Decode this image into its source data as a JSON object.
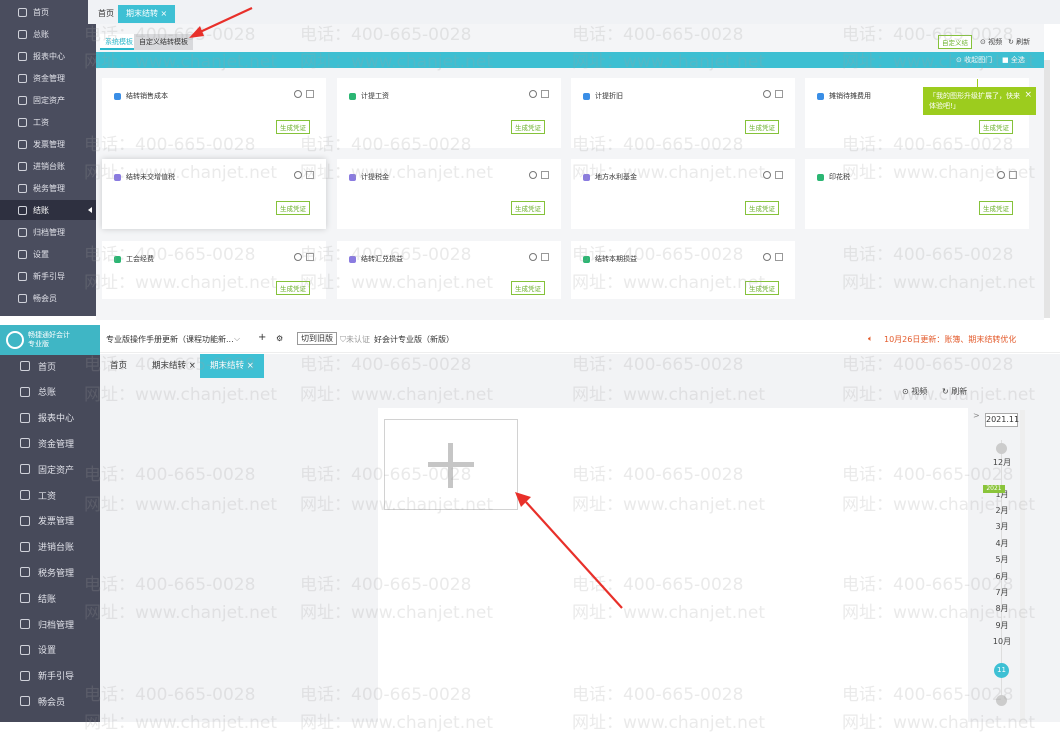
{
  "colors": {
    "accent": "#3ec0d4",
    "sidebar": "#4a4d5e",
    "green": "#85c23a",
    "tip": "#9ccc1e",
    "alert": "#e35a2b"
  },
  "sidebar_top": {
    "items": [
      {
        "label": "首页",
        "icon": "home-icon"
      },
      {
        "label": "总账",
        "icon": "ledger-icon"
      },
      {
        "label": "报表中心",
        "icon": "chart-icon"
      },
      {
        "label": "资金管理",
        "icon": "money-icon"
      },
      {
        "label": "固定资产",
        "icon": "asset-icon"
      },
      {
        "label": "工资",
        "icon": "salary-icon"
      },
      {
        "label": "发票管理",
        "icon": "invoice-icon"
      },
      {
        "label": "进销台账",
        "icon": "inventory-icon"
      },
      {
        "label": "税务管理",
        "icon": "tax-icon"
      },
      {
        "label": "结账",
        "icon": "close-books-icon"
      },
      {
        "label": "归档管理",
        "icon": "archive-icon"
      },
      {
        "label": "设置",
        "icon": "settings-icon"
      },
      {
        "label": "新手引导",
        "icon": "guide-icon"
      },
      {
        "label": "畅会员",
        "icon": "vip-icon"
      }
    ]
  },
  "top": {
    "tabs": [
      "首页",
      "期末结转 ×"
    ],
    "subtabs": [
      "系统模板",
      "自定义结转模板"
    ],
    "toolbar": {
      "select_all_btn": "自定义结",
      "video": "视频",
      "refresh": "刷新",
      "collapse": "收起图门",
      "all": "全选"
    },
    "gen_label": "生成凭证",
    "cards": [
      {
        "title": "结转销售成本"
      },
      {
        "title": "计提工资"
      },
      {
        "title": "计提折旧"
      },
      {
        "title": "摊销待摊费用"
      },
      {
        "title": "结转未交增值税"
      },
      {
        "title": "计提税金"
      },
      {
        "title": "地方水利基金"
      },
      {
        "title": "印花税"
      },
      {
        "title": "工会经费"
      },
      {
        "title": "结转汇兑损益"
      },
      {
        "title": "结转本期损益"
      }
    ],
    "tip": "「我的图形升级扩展了，快来体验吧!」"
  },
  "brand": {
    "line1": "畅捷通好会计",
    "line2": "专业版"
  },
  "header2": {
    "manual": "专业版操作手册更新（课程功能新...",
    "switch": "切到旧版",
    "unverified": "未认证",
    "product": "好会计专业版（新版）",
    "notice": "10月26日更新：账簿、期末结转优化"
  },
  "sidebar_bottom": {
    "items": [
      {
        "label": "首页",
        "icon": "home-icon"
      },
      {
        "label": "总账",
        "icon": "ledger-icon"
      },
      {
        "label": "报表中心",
        "icon": "chart-icon"
      },
      {
        "label": "资金管理",
        "icon": "money-icon"
      },
      {
        "label": "固定资产",
        "icon": "asset-icon"
      },
      {
        "label": "工资",
        "icon": "salary-icon"
      },
      {
        "label": "发票管理",
        "icon": "invoice-icon"
      },
      {
        "label": "进销台账",
        "icon": "inventory-icon"
      },
      {
        "label": "税务管理",
        "icon": "tax-icon"
      },
      {
        "label": "结账",
        "icon": "close-books-icon"
      },
      {
        "label": "归档管理",
        "icon": "archive-icon"
      },
      {
        "label": "设置",
        "icon": "settings-icon"
      },
      {
        "label": "新手引导",
        "icon": "guide-icon"
      },
      {
        "label": "畅会员",
        "icon": "vip-icon"
      }
    ]
  },
  "bottom": {
    "tabs": [
      "首页",
      "期末结转 ×",
      "期末结转 ×"
    ],
    "video": "视频",
    "refresh": "刷新",
    "period": "2021.11",
    "months": [
      "12月",
      "1月",
      "2月",
      "3月",
      "4月",
      "5月",
      "6月",
      "7月",
      "8月",
      "9月",
      "10月"
    ],
    "year_badge": "2021",
    "current": "11"
  },
  "watermark": {
    "phone": "电话：400-665-0028",
    "site": "网址：www.chanjet.net"
  }
}
